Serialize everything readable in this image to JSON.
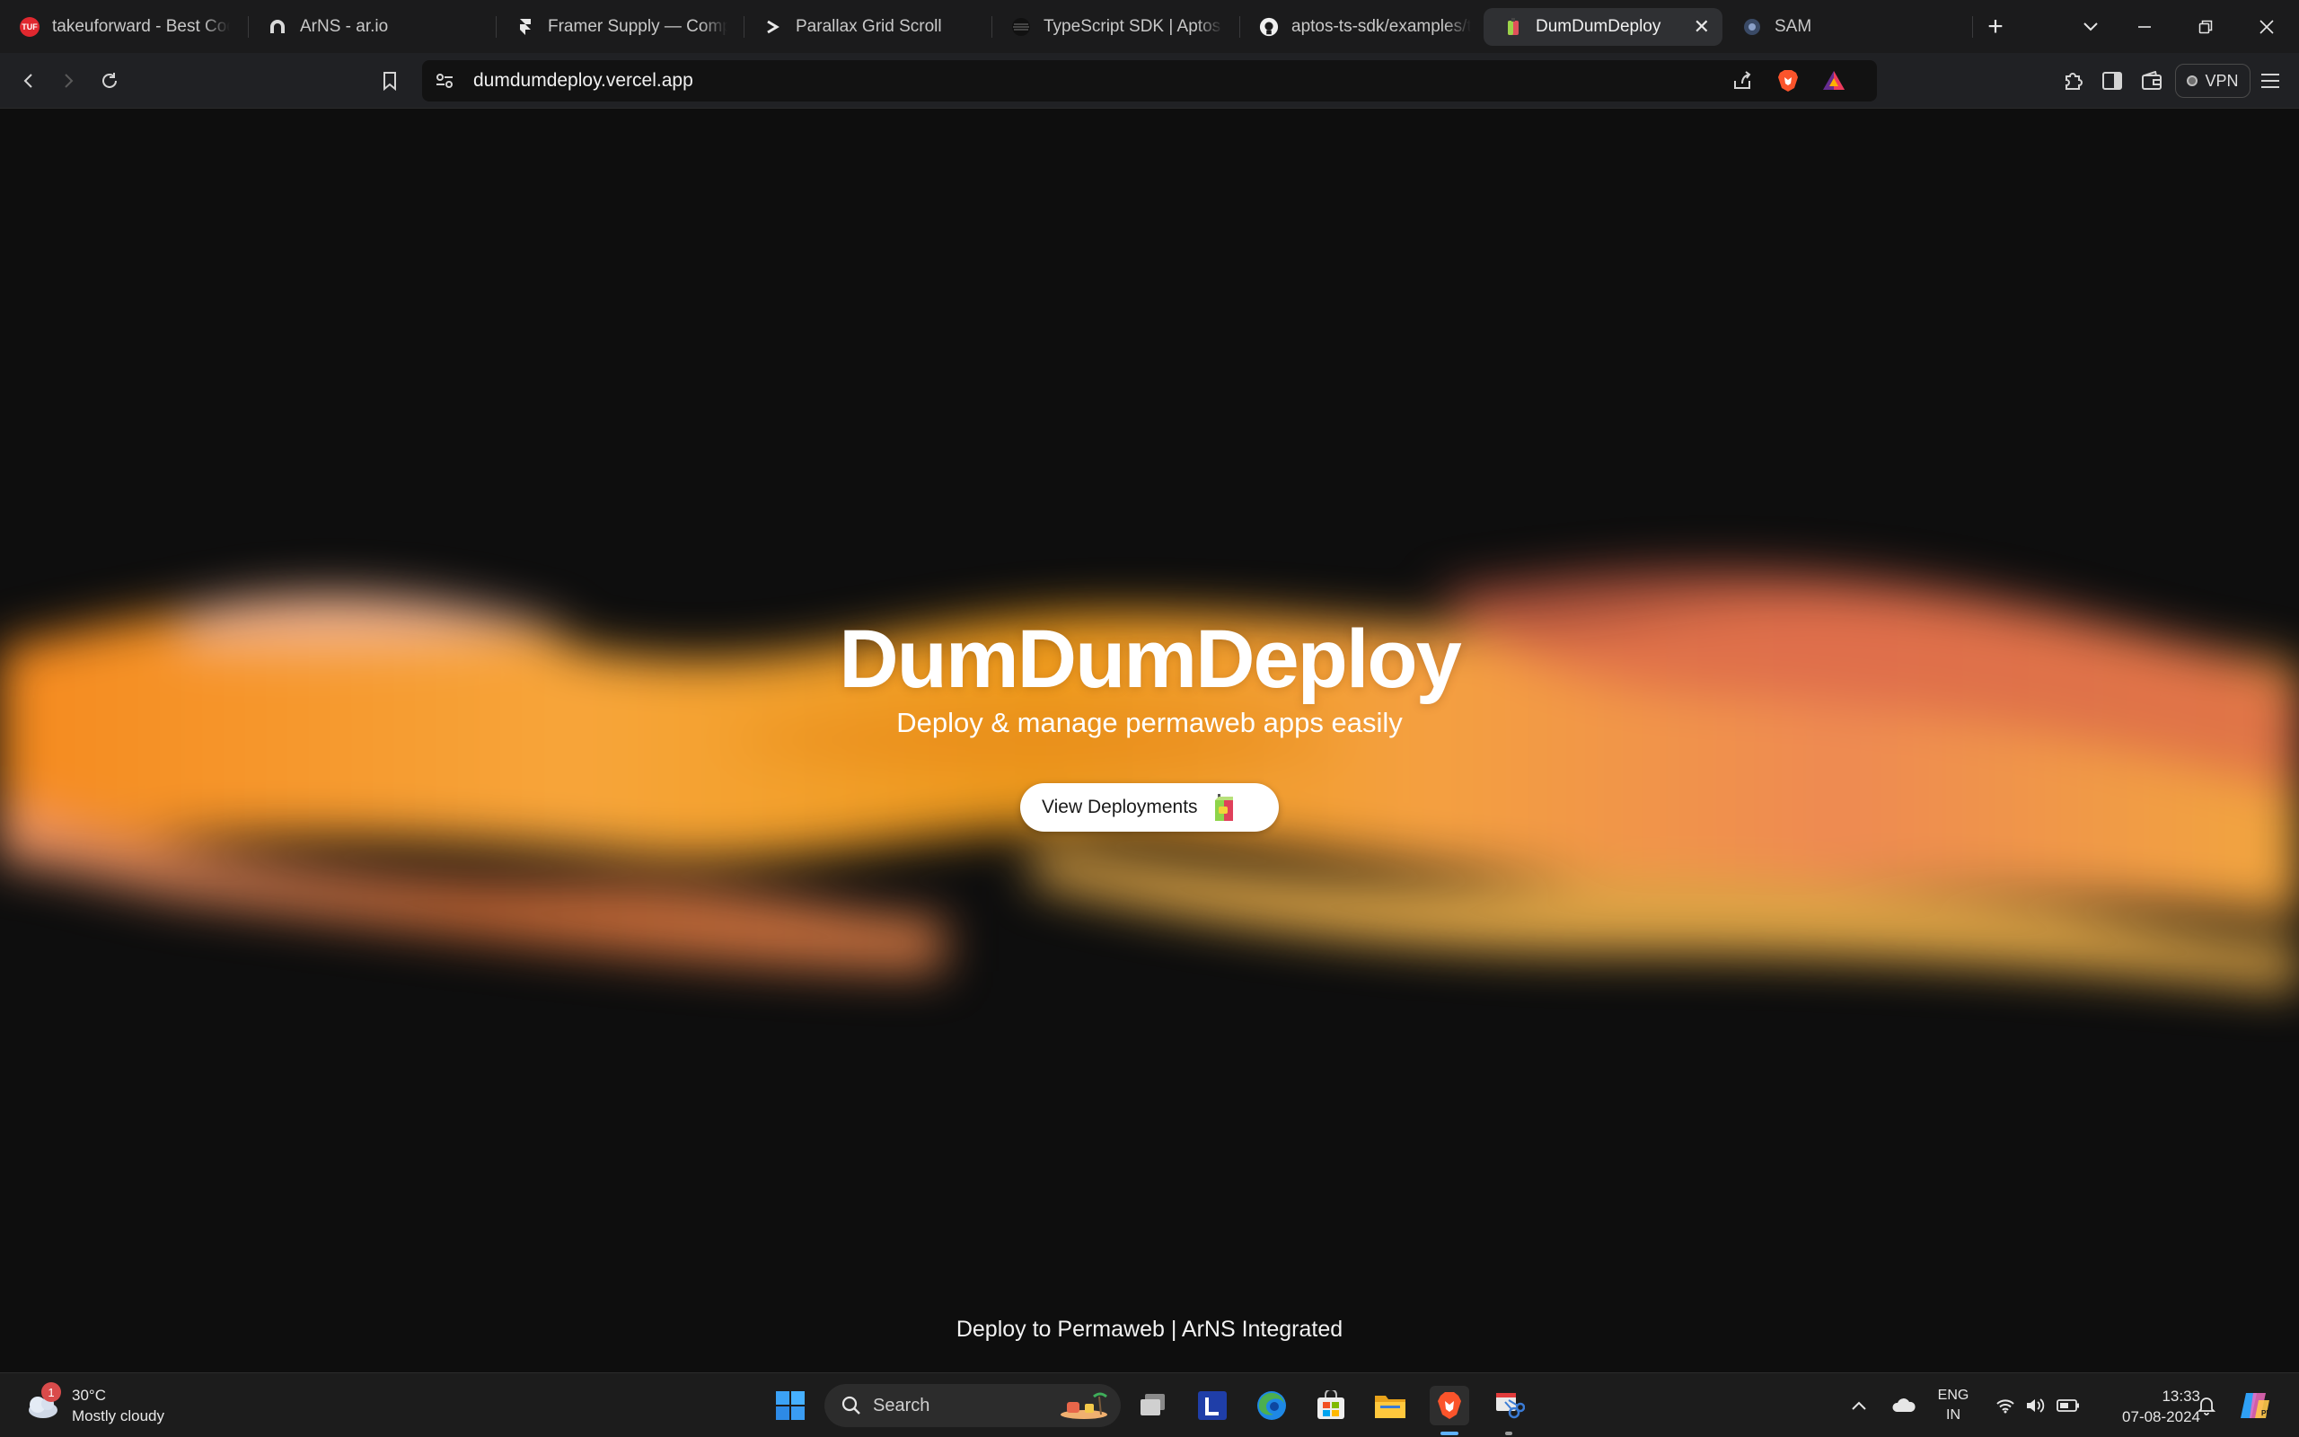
{
  "browser": {
    "tabs": [
      {
        "title": "takeuforward - Best Coding",
        "favicon": "tuf-icon",
        "favicon_text": "TUF"
      },
      {
        "title": "ArNS - ar.io",
        "favicon": "arns-icon"
      },
      {
        "title": "Framer Supply — Components",
        "favicon": "framer-icon"
      },
      {
        "title": "Parallax Grid Scroll",
        "favicon": "chevron-right-icon"
      },
      {
        "title": "TypeScript SDK | Aptos Docs",
        "favicon": "aptos-icon"
      },
      {
        "title": "aptos-ts-sdk/examples/typescript",
        "favicon": "github-icon"
      },
      {
        "title": "DumDumDeploy",
        "favicon": "dumdumdeploy-icon",
        "active": true
      },
      {
        "title": "SAM",
        "favicon": "sam-icon"
      }
    ],
    "close_glyph": "✕",
    "new_tab_glyph": "+",
    "address": "dumdumdeploy.vercel.app",
    "vpn_label": "VPN",
    "accent": "#f28c28"
  },
  "page": {
    "title": "DumDumDeploy",
    "subtitle": "Deploy & manage permaweb apps easily",
    "cta_label": "View Deployments",
    "footer": "Deploy to Permaweb | ArNS Integrated"
  },
  "taskbar": {
    "weather_temp": "30°C",
    "weather_desc": "Mostly cloudy",
    "weather_badge": "1",
    "search_placeholder": "Search",
    "lang_line1": "ENG",
    "lang_line2": "IN",
    "time": "13:33",
    "date": "07-08-2024"
  }
}
